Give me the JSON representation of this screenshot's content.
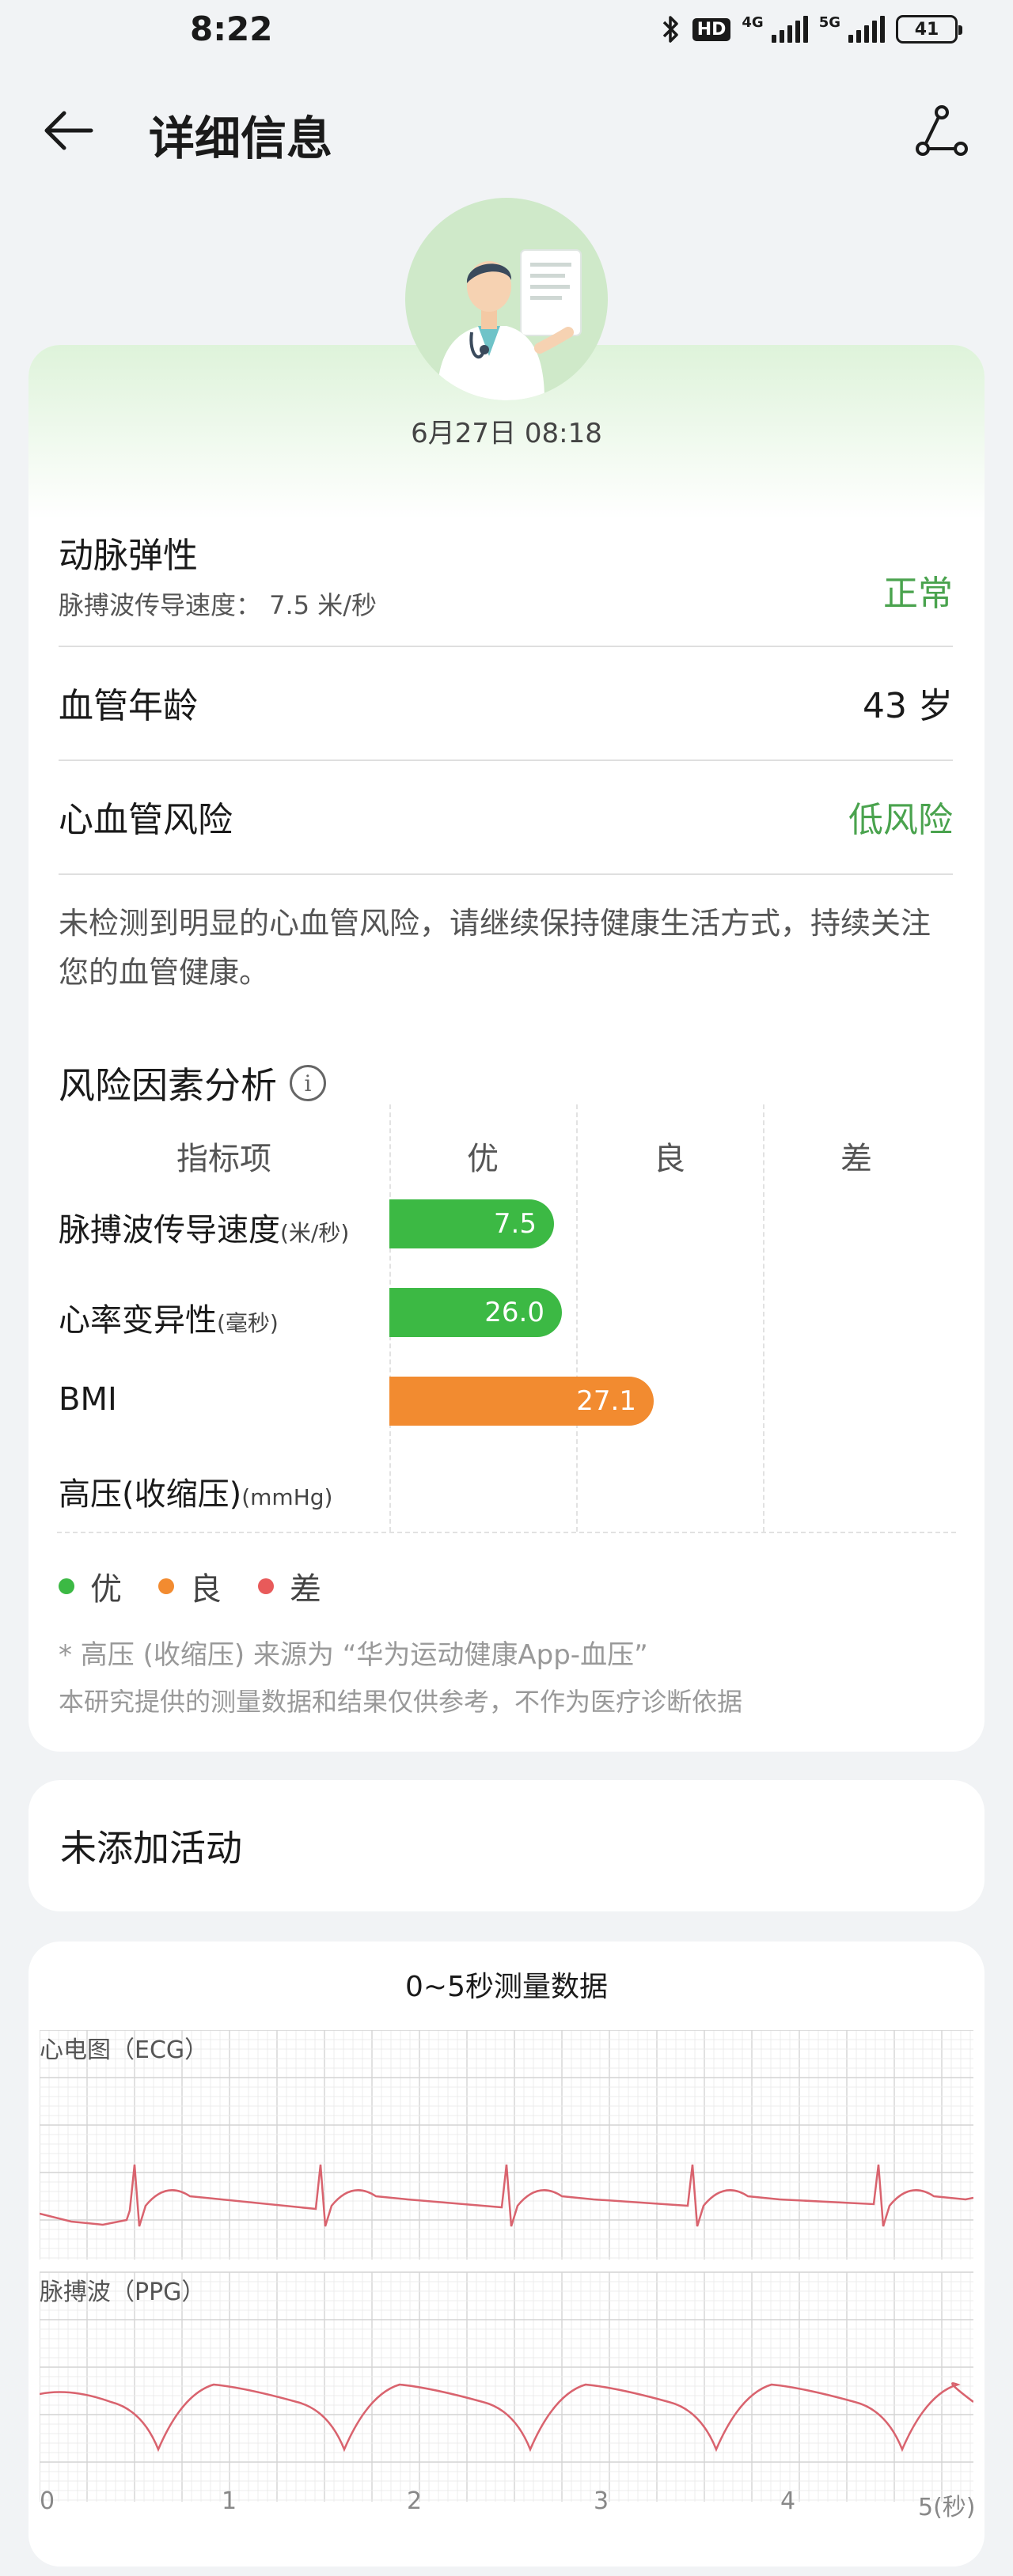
{
  "status_bar": {
    "time": "8:22",
    "hd_label": "HD",
    "net1": "4G",
    "net2": "5G",
    "battery": "41",
    "bluetooth_icon": "bluetooth-icon"
  },
  "header": {
    "title": "详细信息",
    "back_icon": "back-arrow-icon",
    "share_icon": "share-icon"
  },
  "summary": {
    "date": "6月27日 08:18",
    "artery": {
      "title": "动脉弹性",
      "subtitle": "脉搏波传导速度： 7.5 米/秒",
      "value": "正常"
    },
    "vessel_age": {
      "title": "血管年龄",
      "value": "43 岁"
    },
    "cv_risk": {
      "title": "心血管风险",
      "value": "低风险"
    },
    "description": "未检测到明显的心血管风险，请继续保持健康生活方式，持续关注您的血管健康。"
  },
  "risk_analysis": {
    "title": "风险因素分析",
    "columns": [
      "指标项",
      "优",
      "良",
      "差"
    ],
    "metrics": [
      {
        "name": "脉搏波传导速度",
        "unit": "(米/秒)",
        "value": "7.5",
        "level": "优"
      },
      {
        "name": "心率变异性",
        "unit": "(毫秒)",
        "value": "26.0",
        "level": "优"
      },
      {
        "name": "BMI",
        "unit": "",
        "value": "27.1",
        "level": "良"
      },
      {
        "name": "高压(收缩压)",
        "unit": "(mmHg)",
        "value": "",
        "level": ""
      }
    ],
    "legend": [
      {
        "label": "优",
        "color": "#3cb944"
      },
      {
        "label": "良",
        "color": "#f28b30"
      },
      {
        "label": "差",
        "color": "#e85a5a"
      }
    ],
    "note1": "* 高压 (收缩压) 来源为 “华为运动健康App-血压”",
    "note2": "本研究提供的测量数据和结果仅供参考，不作为医疗诊断依据"
  },
  "activity": {
    "text": "未添加活动"
  },
  "waveform": {
    "title": "0~5秒测量数据",
    "ecg_label": "心电图（ECG）",
    "ppg_label": "脉搏波（PPG）",
    "ticks": [
      "0",
      "1",
      "2",
      "3",
      "4",
      "5(秒)"
    ],
    "line_color": "#d9636e"
  }
}
